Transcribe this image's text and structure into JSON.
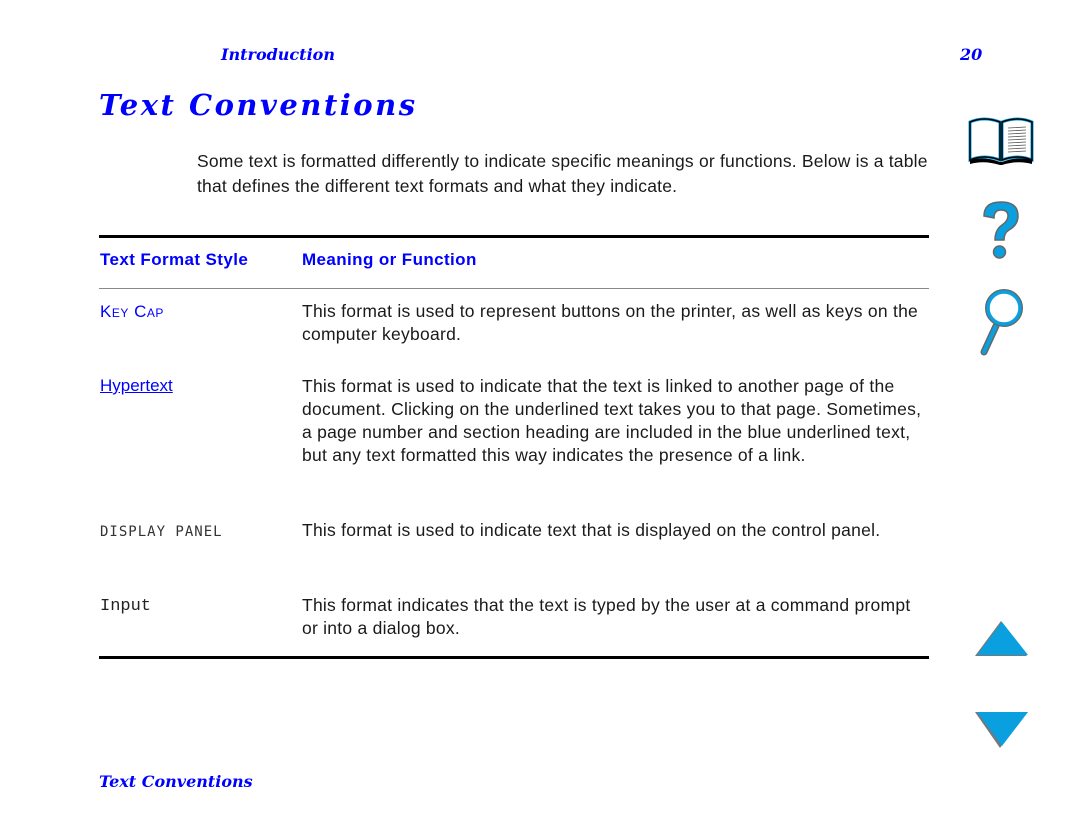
{
  "header": {
    "section": "Introduction",
    "page_number": "20"
  },
  "title": "Text Conventions",
  "intro": "Some text is formatted differently to indicate specific meanings or functions. Below is a table that defines the different text formats and what they indicate.",
  "table": {
    "headers": [
      "Text Format Style",
      "Meaning or Function"
    ],
    "rows": [
      {
        "style": "Key Cap",
        "meaning": "This format is used to represent buttons on the printer, as well as keys on the computer keyboard."
      },
      {
        "style": "Hypertext",
        "meaning": "This format is used to indicate that the text is linked to another page of the document. Clicking on the underlined text takes you to that page. Sometimes, a page number and section heading are included in the blue underlined text, but any text formatted this way indicates the presence of a link."
      },
      {
        "style": "DISPLAY PANEL",
        "meaning": "This format is used to indicate text that is displayed on the control panel."
      },
      {
        "style": "Input",
        "meaning": "This format indicates that the text is typed by the user at a command prompt or into a dialog box."
      }
    ]
  },
  "footer": {
    "link": "Text Conventions"
  },
  "nav_icons": {
    "contents": "book-icon",
    "help": "question-mark-icon",
    "search": "magnifier-icon",
    "previous": "up-arrow-icon",
    "next": "down-arrow-icon"
  },
  "colors": {
    "accent": "#0000ff",
    "icon_fill": "#0aa0e0"
  }
}
